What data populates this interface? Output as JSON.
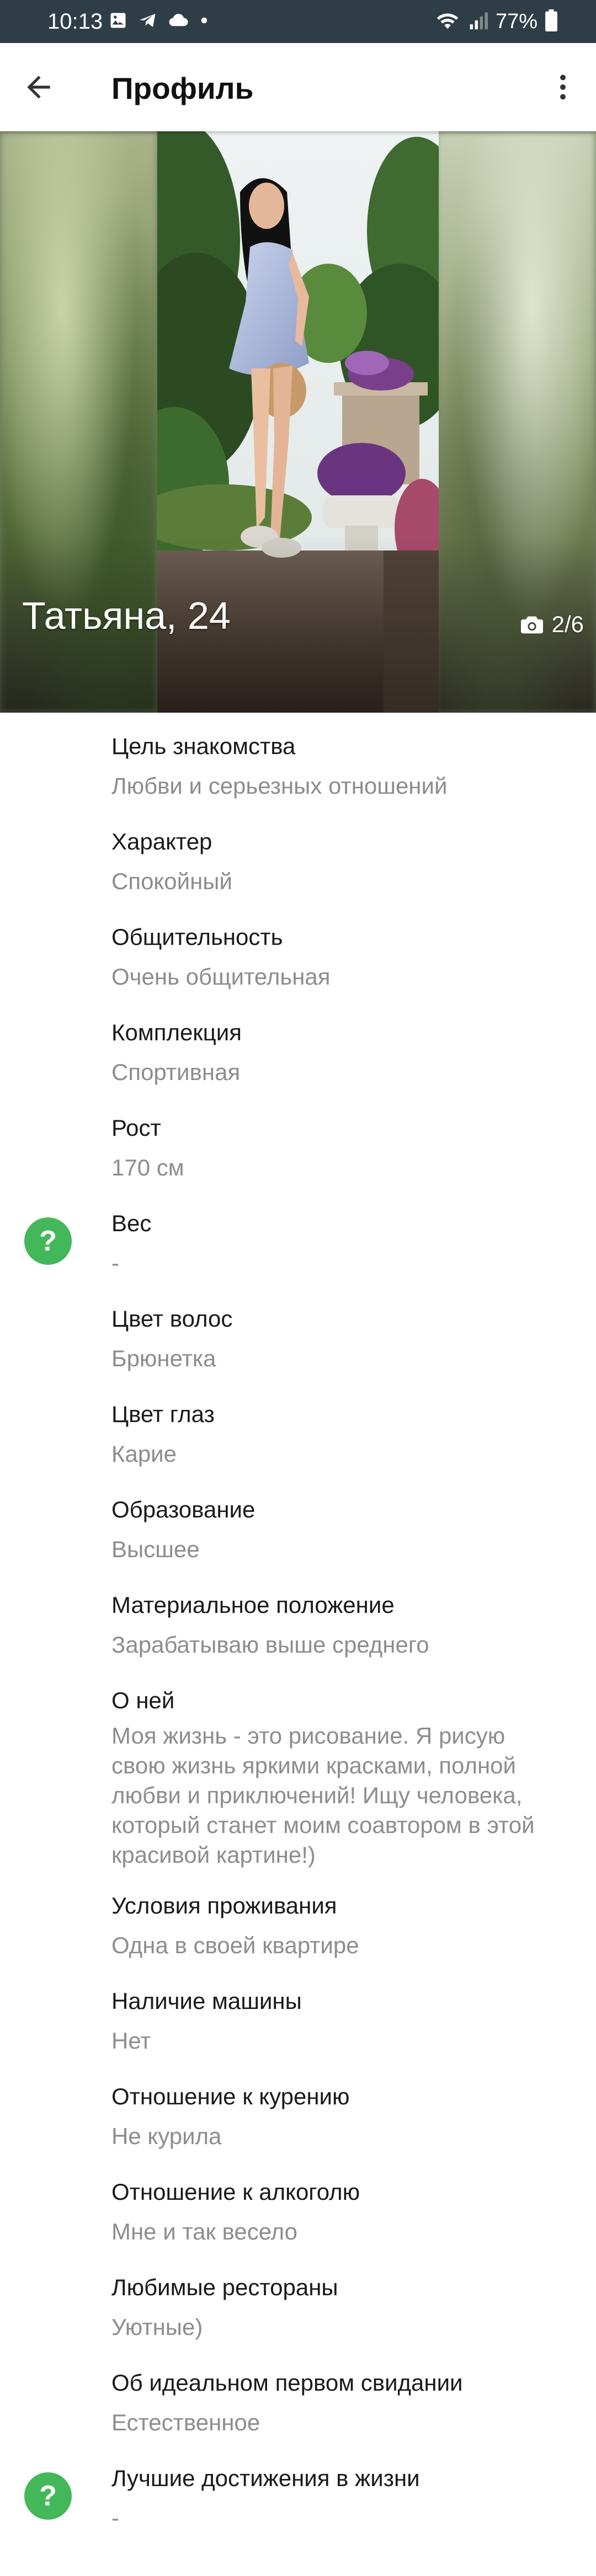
{
  "status_bar": {
    "time": "10:13",
    "battery": "77%",
    "icons_left": [
      "image-icon",
      "telegram-icon",
      "cloud-icon",
      "dot-icon"
    ],
    "icons_right": [
      "wifi-icon",
      "signal-icon",
      "battery-icon"
    ]
  },
  "app_bar": {
    "title": "Профиль",
    "back_icon": "arrow-back-icon",
    "more_icon": "more-vertical-icon"
  },
  "hero": {
    "name_age": "Татьяна, 24",
    "photo_counter": "2/6",
    "camera_icon": "camera-icon"
  },
  "fields": [
    {
      "label": "Цель знакомства",
      "value": "Любви и серьезных отношений"
    },
    {
      "label": "Характер",
      "value": "Спокойный"
    },
    {
      "label": "Общительность",
      "value": "Очень общительная"
    },
    {
      "label": "Комплекция",
      "value": "Спортивная"
    },
    {
      "label": "Рост",
      "value": "170 см"
    },
    {
      "label": "Вес",
      "value": "-",
      "help": "?"
    },
    {
      "label": "Цвет волос",
      "value": "Брюнетка"
    },
    {
      "label": "Цвет глаз",
      "value": "Карие"
    },
    {
      "label": "Образование",
      "value": "Высшее"
    },
    {
      "label": "Материальное положение",
      "value": "Зарабатываю выше среднего"
    },
    {
      "label": "О ней",
      "value": "Моя жизнь - это рисование. Я рисую свою жизнь яркими красками, полной любви и приключений! Ищу человека, который станет моим соавтором в этой красивой картине!)"
    },
    {
      "label": "Условия проживания",
      "value": "Одна в своей квартире"
    },
    {
      "label": "Наличие машины",
      "value": "Нет"
    },
    {
      "label": "Отношение к курению",
      "value": "Не курила"
    },
    {
      "label": "Отношение к алкоголю",
      "value": "Мне и так весело"
    },
    {
      "label": "Любимые рестораны",
      "value": "Уютные)"
    },
    {
      "label": "Об идеальном первом свидании",
      "value": "Естественное"
    },
    {
      "label": "Лучшие достижения в жизни",
      "value": "-",
      "help": "?"
    }
  ],
  "colors": {
    "status_bar": "#2f3e46",
    "help_badge": "#43b85a",
    "value_text": "#8d8d8d"
  }
}
